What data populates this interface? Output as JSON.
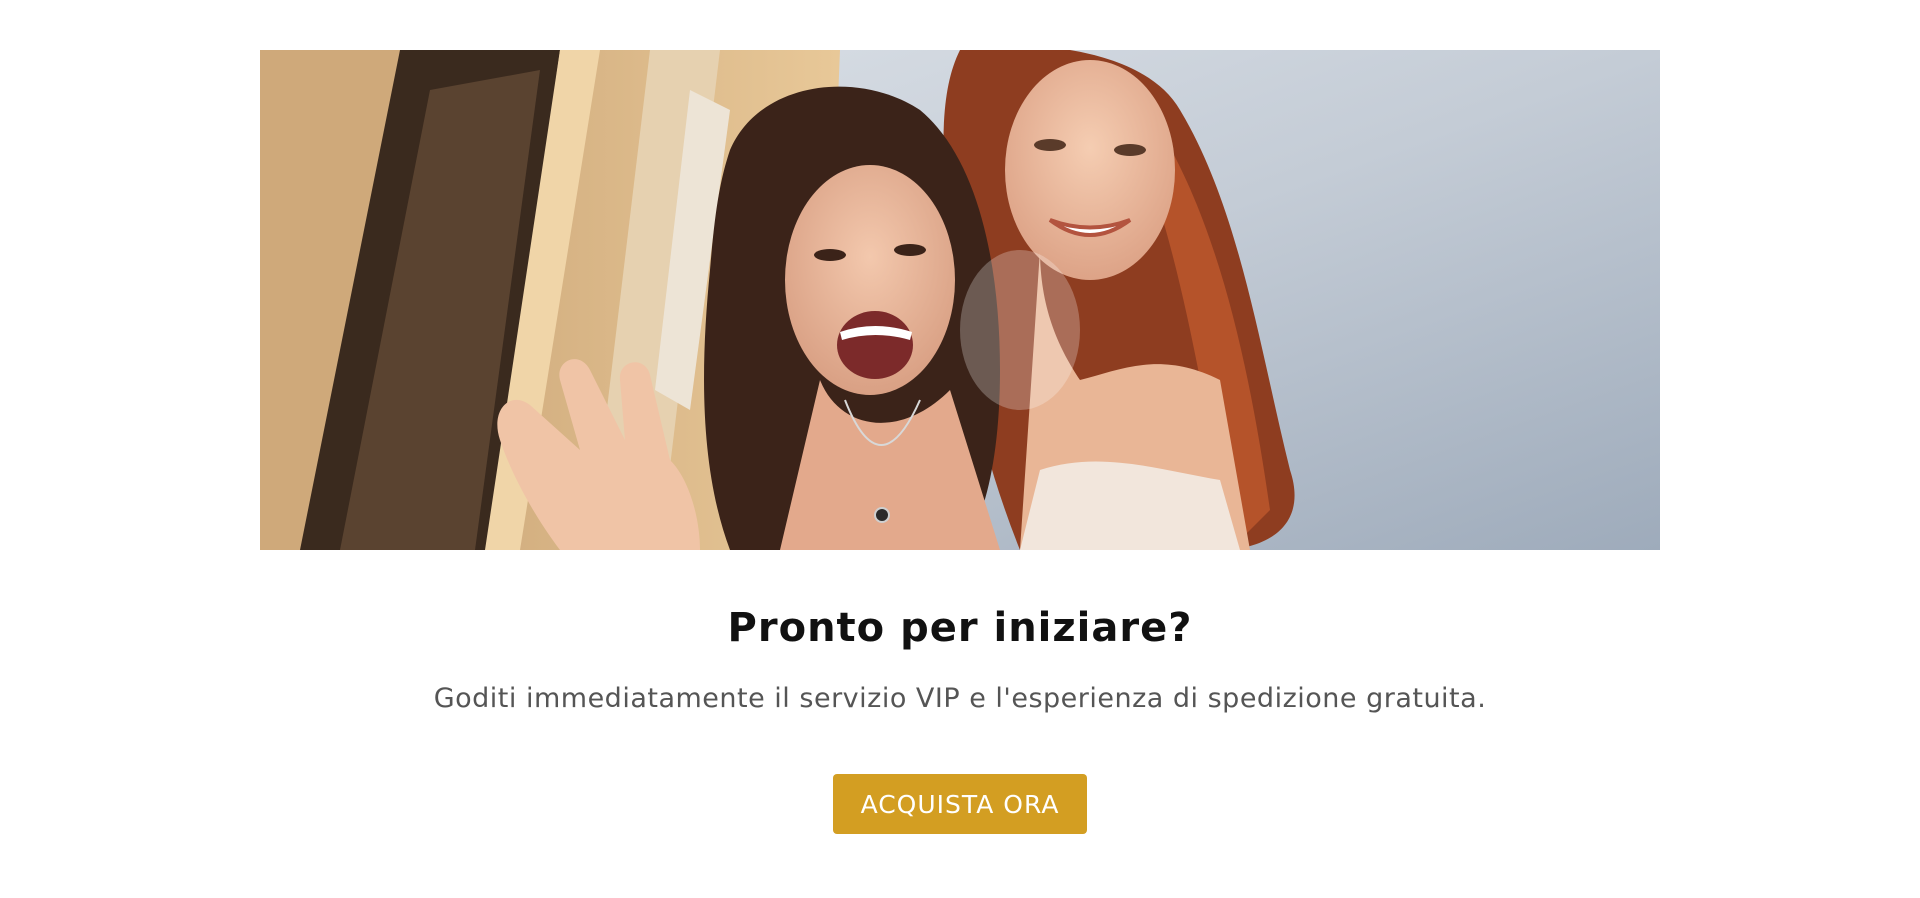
{
  "hero_image": {
    "description_icon": "photo-two-smiling-women-icon"
  },
  "promo": {
    "headline": "Pronto per iniziare?",
    "subtext": "Goditi immediatamente il servizio VIP e l'esperienza di spedizione gratuita.",
    "cta_label": "ACQUISTA ORA"
  },
  "colors": {
    "cta_background": "#D39E22",
    "headline": "#111111",
    "subtext": "#555555"
  }
}
